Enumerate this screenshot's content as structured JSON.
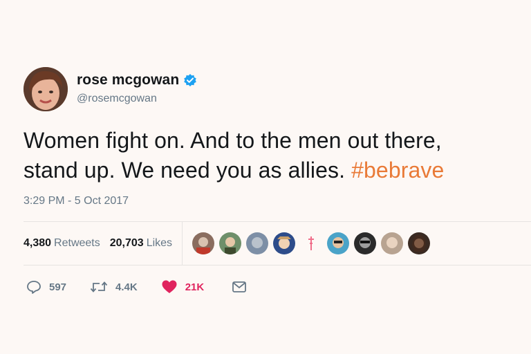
{
  "user": {
    "display_name": "rose mcgowan",
    "handle": "@rosemcgowan",
    "verified": true
  },
  "tweet": {
    "text_line1": "Women fight on. And to the men out there,",
    "text_line2_prefix": "stand up. We need you as allies. ",
    "hashtag": "#bebrave",
    "timestamp": "3:29 PM - 5 Oct 2017"
  },
  "stats": {
    "retweets_count": "4,380",
    "retweets_label": "Retweets",
    "likes_count": "20,703",
    "likes_label": "Likes"
  },
  "actions": {
    "reply_count": "597",
    "retweet_count": "4.4K",
    "like_count": "21K"
  },
  "colors": {
    "background": "#fdf8f5",
    "hashtag": "#e97a37",
    "verified": "#1da1f2",
    "like": "#e0245e",
    "muted": "#657786"
  },
  "icons": [
    "verified-badge-icon",
    "reply-icon",
    "retweet-icon",
    "heart-icon",
    "mail-icon"
  ]
}
